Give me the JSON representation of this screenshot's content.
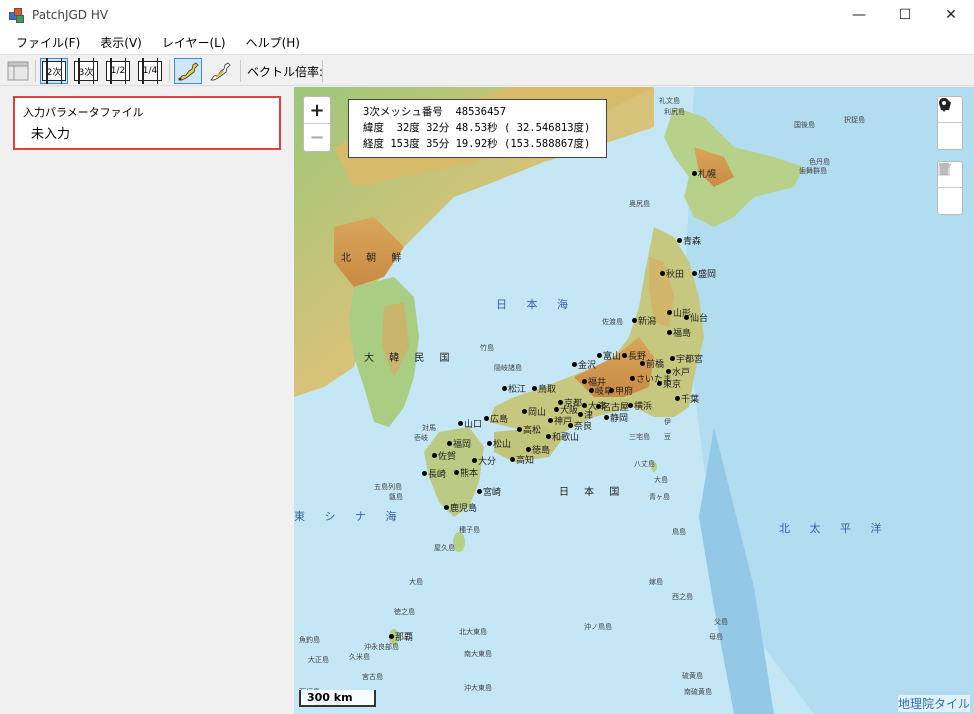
{
  "window": {
    "title": "PatchJGD HV",
    "minimize_glyph": "—",
    "maximize_glyph": "☐",
    "close_glyph": "✕"
  },
  "menu": {
    "items": [
      {
        "label": "ファイル(F)"
      },
      {
        "label": "表示(V)"
      },
      {
        "label": "レイヤー(L)"
      },
      {
        "label": "ヘルプ(H)"
      }
    ]
  },
  "toolbar": {
    "buttons": [
      {
        "label": "2次"
      },
      {
        "label": "3次"
      },
      {
        "label": "1/2"
      },
      {
        "label": "1/4"
      }
    ],
    "vector_scale_label": "ベクトル倍率:"
  },
  "param_panel": {
    "title": "入力パラメータファイル",
    "value": "未入力"
  },
  "map": {
    "zoom_in": "+",
    "zoom_out": "−",
    "info_lines": [
      "3次メッシュ番号  48536457",
      "緯度  32度 32分 48.53秒 ( 32.546813度)",
      "経度 153度 35分 19.92秒 (153.588867度)"
    ],
    "scale_label": "300 km",
    "attribution": "地理院タイル",
    "sea_labels": {
      "japan_sea": "日 本 海",
      "east_china_sea": "東 シ ナ 海",
      "pacific": "北 太 平 洋"
    },
    "country_labels": {
      "north_korea": "北 朝 鮮",
      "south_korea": "大 韓 民 国",
      "japan": "日 本 国"
    },
    "cities": [
      {
        "name": "札幌"
      },
      {
        "name": "青森"
      },
      {
        "name": "秋田"
      },
      {
        "name": "盛岡"
      },
      {
        "name": "山形"
      },
      {
        "name": "仙台"
      },
      {
        "name": "新潟"
      },
      {
        "name": "福島"
      },
      {
        "name": "富山"
      },
      {
        "name": "長野"
      },
      {
        "name": "前橋"
      },
      {
        "name": "宇都宮"
      },
      {
        "name": "金沢"
      },
      {
        "name": "水戸"
      },
      {
        "name": "さいたま"
      },
      {
        "name": "福井"
      },
      {
        "name": "東京"
      },
      {
        "name": "岐阜"
      },
      {
        "name": "甲府"
      },
      {
        "name": "松江"
      },
      {
        "name": "鳥取"
      },
      {
        "name": "千葉"
      },
      {
        "name": "名古屋"
      },
      {
        "name": "横浜"
      },
      {
        "name": "京都"
      },
      {
        "name": "大津"
      },
      {
        "name": "山口"
      },
      {
        "name": "広島"
      },
      {
        "name": "岡山"
      },
      {
        "name": "大阪"
      },
      {
        "name": "神戸"
      },
      {
        "name": "津"
      },
      {
        "name": "静岡"
      },
      {
        "name": "奈良"
      },
      {
        "name": "高松"
      },
      {
        "name": "福岡"
      },
      {
        "name": "松山"
      },
      {
        "name": "和歌山"
      },
      {
        "name": "徳島"
      },
      {
        "name": "佐賀"
      },
      {
        "name": "高知"
      },
      {
        "name": "大分"
      },
      {
        "name": "長崎"
      },
      {
        "name": "熊本"
      },
      {
        "name": "宮崎"
      },
      {
        "name": "鹿児島"
      },
      {
        "name": "那覇"
      }
    ],
    "small_labels": [
      "礼文島",
      "利尻島",
      "奥尻島",
      "国後島",
      "択捉島",
      "色丹島",
      "歯舞群島",
      "佐渡島",
      "竹島",
      "隠岐諸島",
      "対馬",
      "壱岐",
      "五島列島",
      "甑島",
      "種子島",
      "屋久島",
      "大島",
      "徳之島",
      "沖永良部島",
      "伊",
      "豆",
      "三宅島",
      "八丈島",
      "大島",
      "青ヶ島",
      "鳥島",
      "嫁島",
      "西之島",
      "父島",
      "母島",
      "硫黄島",
      "南硫黄島",
      "北大東島",
      "南大東島",
      "沖大東島",
      "久米島",
      "宮古島",
      "石垣島",
      "与那国島",
      "大正島",
      "魚釣島",
      "沖ノ鳥島"
    ]
  }
}
